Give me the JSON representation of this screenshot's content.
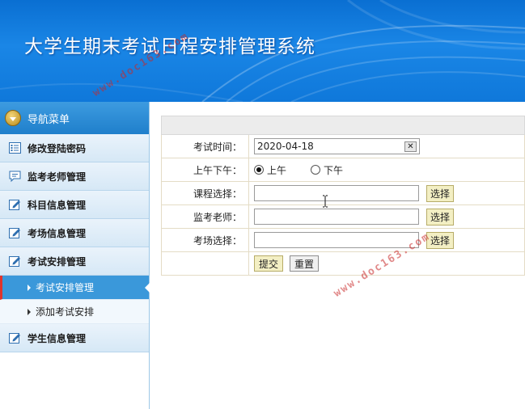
{
  "header": {
    "title": "大学生期末考试日程安排管理系统"
  },
  "sidebar": {
    "nav_label": "导航菜单",
    "items": [
      {
        "label": "修改登陆密码",
        "icon": "list-icon"
      },
      {
        "label": "监考老师管理",
        "icon": "chat-icon"
      },
      {
        "label": "科目信息管理",
        "icon": "edit-icon"
      },
      {
        "label": "考场信息管理",
        "icon": "edit-icon"
      },
      {
        "label": "考试安排管理",
        "icon": "edit-icon"
      }
    ],
    "subitems": [
      {
        "label": "考试安排管理",
        "active": true
      },
      {
        "label": "添加考试安排",
        "active": false
      }
    ],
    "last_item": {
      "label": "学生信息管理",
      "icon": "edit-icon"
    }
  },
  "form": {
    "exam_time": {
      "label": "考试时间：",
      "value": "2020-04-18",
      "clear": "✕"
    },
    "period": {
      "label": "上午下午：",
      "options": [
        "上午",
        "下午"
      ],
      "selected": "上午"
    },
    "course": {
      "label": "课程选择：",
      "value": "",
      "button": "选择"
    },
    "teacher": {
      "label": "监考老师：",
      "value": "",
      "button": "选择"
    },
    "room": {
      "label": "考场选择：",
      "value": "",
      "button": "选择"
    },
    "submit_label": "提交",
    "reset_label": "重置"
  },
  "watermark": {
    "text1": "www.doc163.com",
    "text2": "www.doc163.com"
  },
  "colors": {
    "header_blue": "#0f78da",
    "sidebar_active": "#3a98da",
    "accent_red": "#e0342c"
  }
}
